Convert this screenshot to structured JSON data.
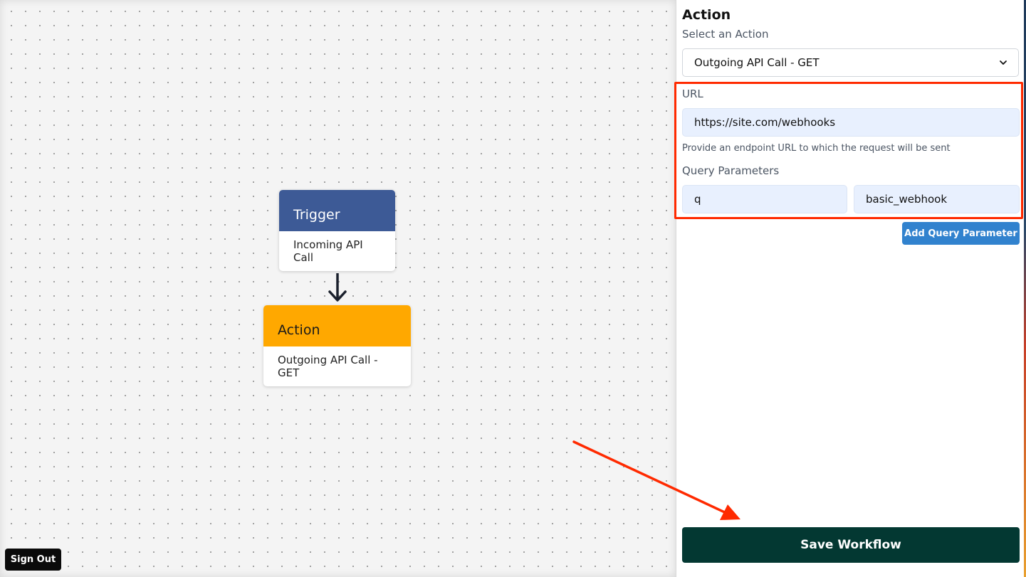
{
  "canvas": {
    "trigger_node": {
      "header": "Trigger",
      "body": "Incoming API Call",
      "color": "#3d5a96"
    },
    "action_node": {
      "header": "Action",
      "body": "Outgoing API Call - GET",
      "color": "#ffa800"
    },
    "sign_out_label": "Sign Out"
  },
  "panel": {
    "title": "Action",
    "select_label": "Select an Action",
    "selected_action": "Outgoing API Call - GET",
    "url_label": "URL",
    "url_value": "https://site.com/webhooks",
    "url_help": "Provide an endpoint URL to which the request will be sent",
    "query_params_label": "Query Parameters",
    "query_params": [
      {
        "key": "q",
        "value": "basic_webhook"
      }
    ],
    "add_query_param_label": "Add Query Parameter",
    "save_label": "Save Workflow"
  },
  "colors": {
    "highlight": "#ff2a00",
    "save_button": "#033832",
    "add_button": "#3182ce",
    "input_bg": "#e8f0fe"
  },
  "icons": {
    "connector": "arrow-down-icon",
    "select": "chevron-down-icon",
    "annotation": "annotation-arrow-icon"
  }
}
